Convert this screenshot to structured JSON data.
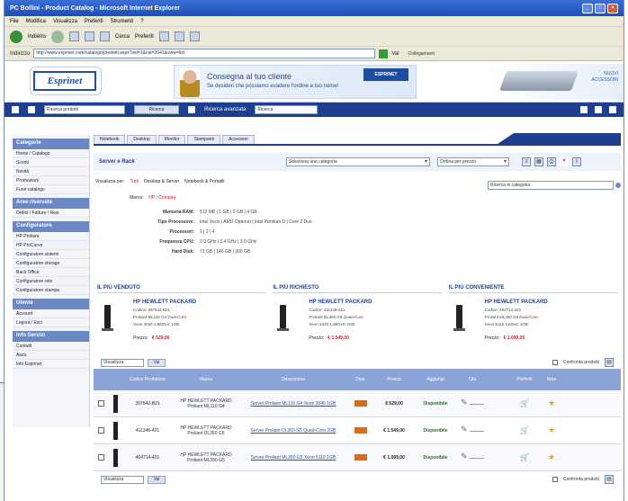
{
  "window": {
    "title": "PC Bollini - Product Catalog - Microsoft Internet Explorer"
  },
  "menu": [
    "File",
    "Modifica",
    "Visualizza",
    "Preferiti",
    "Strumenti",
    "?"
  ],
  "toolbar": {
    "back_label": "Indietro",
    "search_label": "Cerca",
    "favorites_label": "Preferiti"
  },
  "address": {
    "label": "Indirizzo",
    "url": "http://www.esprinet.com/catalogo/prodotti.aspx?sel=1&cat=2041&view=list",
    "vai_label": "Vai",
    "links_label": "Collegamenti"
  },
  "banner": {
    "logo_text": "Esprinet",
    "ad_title": "Consegna al tuo cliente",
    "ad_subtitle": "Se desideri che possiamo evadere l'ordine a tuo nome!",
    "ad_logo": "ESPRINET",
    "ad_right_text": "NUOVI ACCESSORI"
  },
  "nav": {
    "search_placeholder": "Ricerca prodotti",
    "search_button": "Ricerca",
    "mid_label": "Ricerca avanzata",
    "select_value": "Ricerca"
  },
  "sidebar": {
    "sections": [
      {
        "title": "Categorie",
        "items": [
          "Home / Catalogo",
          "Sconti",
          "Novità",
          "Promozioni",
          "Fuori catalogo"
        ]
      },
      {
        "title": "Aree riservate",
        "items": [
          "Ordini / Fatture / Resi"
        ]
      },
      {
        "title": "Configuratore",
        "items": [
          "HP Proliant",
          "HP ProCurve",
          "Configuratore sistemi",
          "Configuratore storage",
          "Back Office",
          "Configuratore rete",
          "Configuratore stampa"
        ]
      },
      {
        "title": "Utente",
        "items": [
          "Account",
          "Logout / Esci"
        ]
      },
      {
        "title": "Info Servizi",
        "items": [
          "Contatti",
          "Aiuto",
          "Info Esprinet"
        ]
      }
    ]
  },
  "tabs": [
    "Notebook",
    "Desktop",
    "Monitor",
    "Stampanti",
    "Accessori"
  ],
  "filter": {
    "title": "Server e Rack",
    "category_select": "Seleziona una categoria",
    "order_select": "Ordina per prezzo"
  },
  "options": {
    "prefix": "Visualizza per:",
    "links": [
      "Tutti",
      "Desktop & Server",
      "Notebook & Portatili"
    ],
    "brand_label": "Marca:",
    "brand_value": "HP / Compaq",
    "search_placeholder": "Ricerca in categoria"
  },
  "specs": [
    {
      "k": "Memoria RAM:",
      "v": "512 MB | 1 GB | 2 GB | 4 GB"
    },
    {
      "k": "Tipo Processore:",
      "v": "Intel Xeon | AMD Opteron | Intel Pentium D | Core 2 Duo"
    },
    {
      "k": "Processori:",
      "v": "1 | 2 | 4"
    },
    {
      "k": "Frequenza CPU:",
      "v": "2.0 GHz | 2.4 GHz | 3.0 GHz"
    },
    {
      "k": "Hard Disk:",
      "v": "73 GB | 146 GB | 300 GB"
    }
  ],
  "featured": [
    {
      "head": "IL PIÙ VENDUTO",
      "brand": "HP HEWLETT PACKARD",
      "l1": "Codice: 397542-B21",
      "l2": "Proliant ML110 G4 Dual-Core",
      "l3": "Xeon 3040 1.86GHz 1GB",
      "price_label": "Prezzo:",
      "price": "€ 529,00"
    },
    {
      "head": "IL PIÙ RICHIESTO",
      "brand": "HP HEWLETT PACKARD",
      "l1": "Codice: 411346-421",
      "l2": "Proliant DL360 G5 Quad-Core",
      "l3": "Xeon 5320 1.86GHz 2GB",
      "price_label": "Prezzo:",
      "price": "€ 1.549,00"
    },
    {
      "head": "IL PIÙ CONVENIENTE",
      "brand": "HP HEWLETT PACKARD",
      "l1": "Codice: 404714-421",
      "l2": "Proliant ML350 G5 Dual-Core",
      "l3": "Xeon 5110 1.6GHz 1GB",
      "price_label": "Prezzo:",
      "price": "€ 1.099,00"
    }
  ],
  "pager": {
    "select": "Visualizza",
    "go": "Vai",
    "compare": "Confronta prodotti"
  },
  "table": {
    "headers": [
      "",
      "",
      "Codice Produttore",
      "Marca",
      "Descrizione",
      "Disp.",
      "Prezzo",
      "Aggiungi",
      "Qta",
      "",
      "Preferiti",
      "Note"
    ],
    "rows": [
      {
        "code": "397542-B21",
        "brand": "HP HEWLETT PACKARD",
        "sub": "Proliant ML110 G4",
        "desc": "Server Proliant ML110 G4 Xeon 3040 1GB",
        "price": "€ 529,00",
        "disp": "Disponibile"
      },
      {
        "code": "411346-421",
        "brand": "HP HEWLETT PACKARD",
        "sub": "Proliant DL360 G5",
        "desc": "Server Proliant DL360 G5 Quad-Core 2GB",
        "price": "€ 1.549,00",
        "disp": "Disponibile"
      },
      {
        "code": "404714-421",
        "brand": "HP HEWLETT PACKARD",
        "sub": "Proliant ML350 G5",
        "desc": "Server Proliant ML350 G5 Xeon 5110 1GB",
        "price": "€ 1.099,00",
        "disp": "Disponibile"
      }
    ]
  },
  "colors": {
    "accent": "#1e3f8f",
    "header": "#8aa4d8",
    "availability": "#e06a10",
    "price_red": "#cc2222"
  }
}
